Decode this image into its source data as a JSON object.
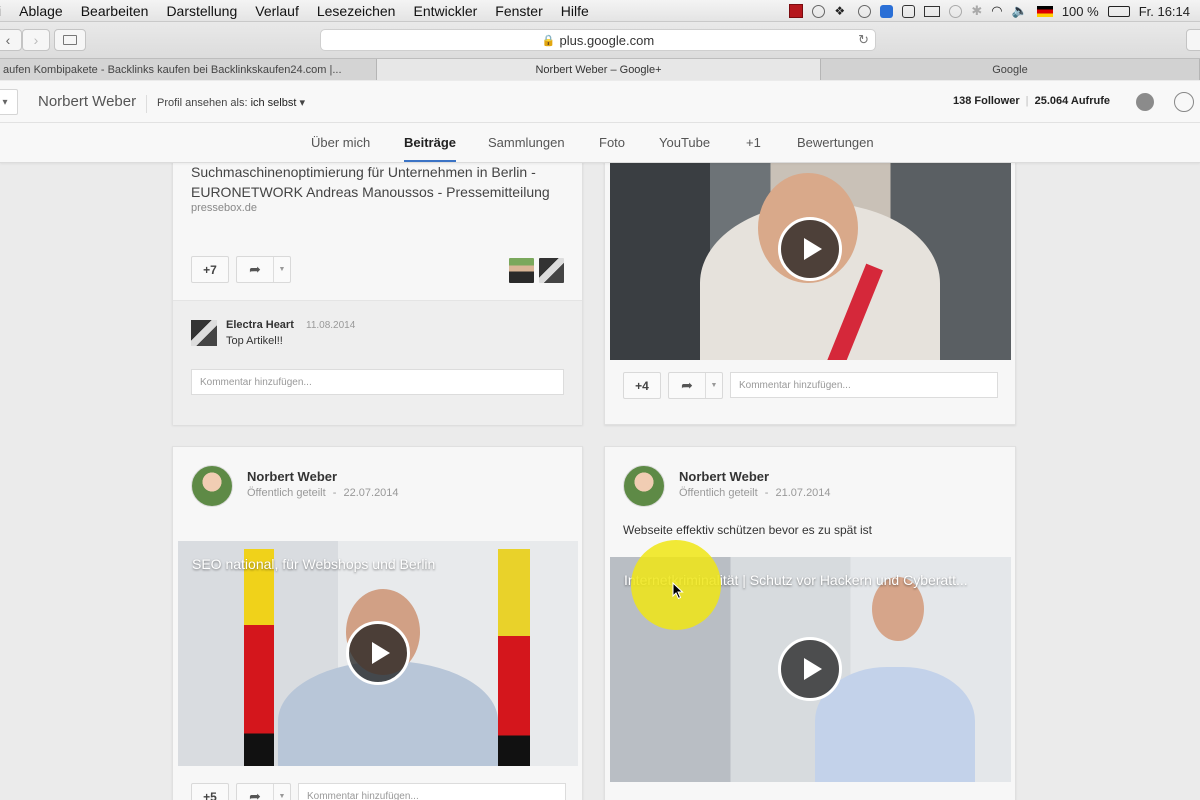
{
  "menubar": {
    "items": [
      "Ablage",
      "Bearbeiten",
      "Darstellung",
      "Verlauf",
      "Lesezeichen",
      "Entwickler",
      "Fenster",
      "Hilfe"
    ],
    "first": "i",
    "battery": "100 %",
    "clock": "Fr. 16:14"
  },
  "browser": {
    "url": "plus.google.com",
    "tabs": [
      "aufen Kombipakete - Backlinks kaufen bei Backlinkskaufen24.com |...",
      "Norbert Weber – Google+",
      "Google"
    ]
  },
  "profile": {
    "name": "Norbert Weber",
    "view_as_label": "Profil ansehen als:",
    "view_as_value": "ich selbst",
    "followers": "138 Follower",
    "separator": "|",
    "views": "25.064 Aufrufe",
    "tabs": [
      "Über mich",
      "Beiträge",
      "Sammlungen",
      "Foto",
      "YouTube",
      "+1",
      "Bewertungen"
    ],
    "active_tab": "Beiträge"
  },
  "posts": {
    "p1": {
      "title": "Suchmaschinenoptimierung für Unternehmen in Berlin - EURONETWORK Andreas Manoussos - Pressemitteilung",
      "source": "pressebox.de",
      "plus_count": "+7",
      "comment_author": "Electra Heart",
      "comment_date": "11.08.2014",
      "comment_text": "Top Artikel!!",
      "comment_placeholder": "Kommentar hinzufügen..."
    },
    "p2": {
      "plus_count": "+4",
      "comment_placeholder": "Kommentar hinzufügen..."
    },
    "p3": {
      "author": "Norbert Weber",
      "visibility": "Öffentlich geteilt",
      "date": "22.07.2014",
      "video_title": "SEO national, für Webshops und Berlin",
      "plus_count": "+5",
      "comment_placeholder": "Kommentar hinzufügen..."
    },
    "p4": {
      "author": "Norbert Weber",
      "visibility": "Öffentlich geteilt",
      "date": "21.07.2014",
      "text": "Webseite effektiv schützen bevor es zu spät ist",
      "video_title": "Internetkriminalität | Schutz vor Hackern und Cyberatt..."
    },
    "date_separator": "-"
  },
  "colors": {
    "accent": "#3b73c5",
    "highlight": "#f0e614"
  },
  "icons": {
    "play": "play-icon",
    "share": "share-arrow-icon",
    "bell": "notification-bell-icon"
  }
}
